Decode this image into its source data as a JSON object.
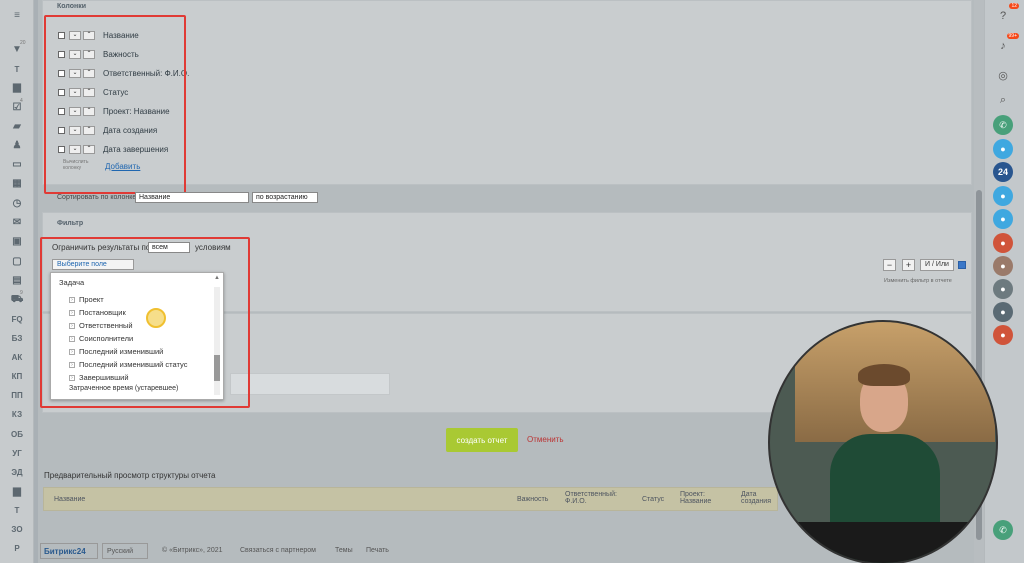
{
  "sidebar_left": {
    "items": [
      "Т",
      "FQ",
      "БЗ",
      "АК",
      "КП",
      "ПП",
      "КЗ",
      "ОБ",
      "УГ",
      "ЭД",
      "Т",
      "ЗО",
      "Р"
    ],
    "badges": [
      "20",
      "4",
      "9"
    ]
  },
  "columns_section": {
    "title": "Колонки",
    "items": [
      "Название",
      "Важность",
      "Ответственный: Ф.И.О.",
      "Статус",
      "Проект: Название",
      "Дата создания",
      "Дата завершения"
    ],
    "calc_label": "Вычислить колонку",
    "add_link": "Добавить"
  },
  "sort": {
    "label": "Сортировать по колонке",
    "field_value": "Название",
    "order_value": "по возрастанию"
  },
  "filter": {
    "title": "Фильтр",
    "limit_label_before": "Ограничить результаты по",
    "limit_value": "всем",
    "limit_label_after": "условиям",
    "select_field_label": "Выберите поле",
    "and_or_label": "И / Или",
    "minus": "−",
    "plus": "+",
    "change_filter_label": "Изменить фильтр в отчете"
  },
  "dropdown": {
    "group": "Задача",
    "items": [
      "Проект",
      "Постановщик",
      "Ответственный",
      "Соисполнители",
      "Последний изменивший",
      "Последний изменивший статус",
      "Завершивший"
    ],
    "bottom_item": "Затраченное время (устаревшее)"
  },
  "actions": {
    "create_label": "создать отчет",
    "cancel_label": "Отменить"
  },
  "preview": {
    "title": "Предварительный просмотр структуры отчета",
    "headers": [
      "Название",
      "Важность",
      "Ответственный: Ф.И.О.",
      "Статус",
      "Проект: Название",
      "Дата создания"
    ]
  },
  "footer": {
    "brand": "Битрикс24",
    "language": "Русский",
    "copyright": "© «Битрикс», 2021",
    "partner": "Связаться с партнером",
    "themes": "Темы",
    "print": "Печать"
  },
  "rightbar": {
    "badge_top": "12",
    "badge_bell": "99+",
    "label_24": "24"
  },
  "colors": {
    "accent_green": "#a9c933",
    "highlight_red": "#e03a35",
    "cancel_red": "#b33333"
  }
}
